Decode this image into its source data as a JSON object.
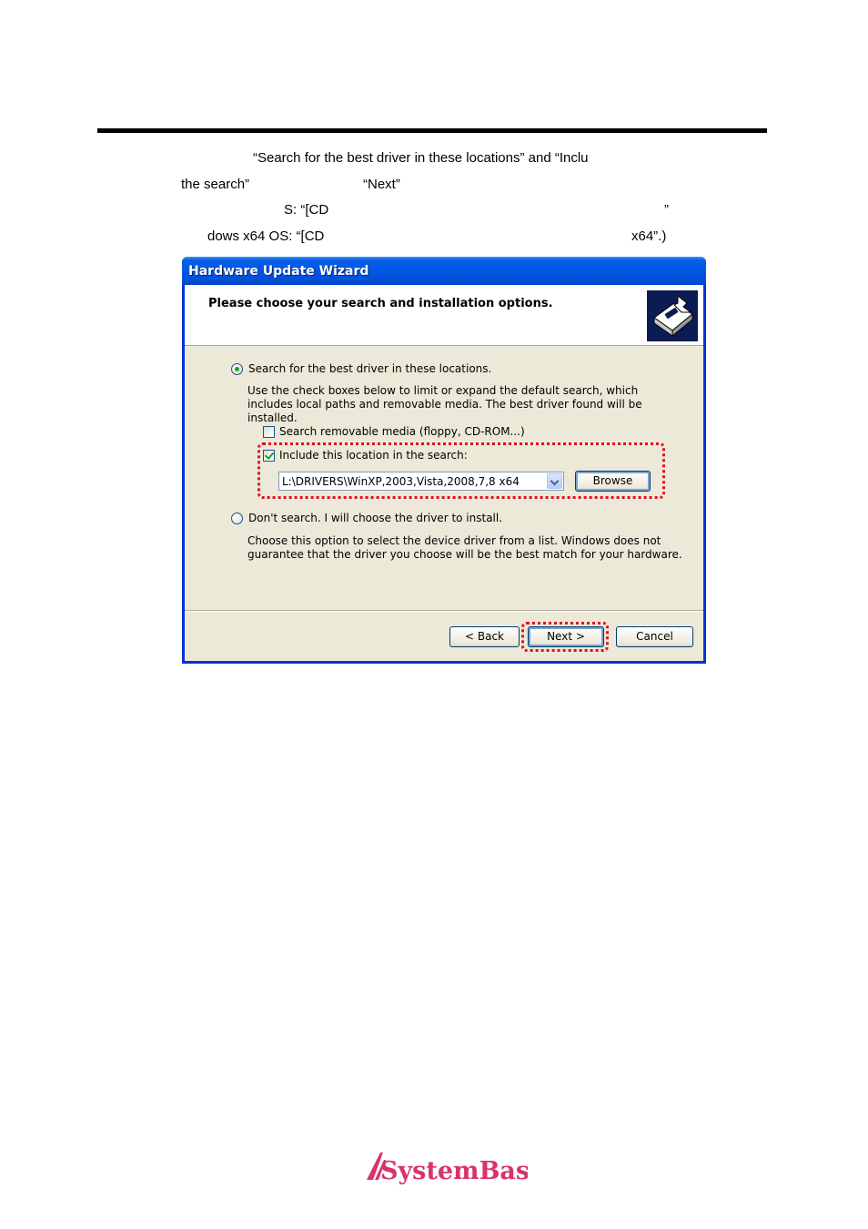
{
  "doc": {
    "line1": "“Search for the best driver in these locations” and “Inclu",
    "line2a": "the search”",
    "line2b": "“Next”",
    "line3a": "S: “[CD",
    "line3b": "”",
    "line4a": "dows x64 OS: “[CD",
    "line4b": "x64”.)"
  },
  "dialog": {
    "title": "Hardware Update Wizard",
    "header_title": "Please choose your search and installation options.",
    "header_icon": "hardware-install-icon",
    "option_search": {
      "label": "Search for the best driver in these locations.",
      "selected": true,
      "description": "Use the check boxes below to limit or expand the default search, which includes local paths and removable media. The best driver found will be installed."
    },
    "check_removable": {
      "label": "Search removable media (floppy, CD-ROM...)",
      "checked": false
    },
    "check_location": {
      "label": "Include this location in the search:",
      "checked": true
    },
    "location_value": "L:\\DRIVERS\\WinXP,2003,Vista,2008,7,8 x64",
    "browse_label": "Browse",
    "option_dont_search": {
      "label": "Don't search. I will choose the driver to install.",
      "selected": false,
      "description": "Choose this option to select the device driver from a list.  Windows does not guarantee that the driver you choose will be the best match for your hardware."
    },
    "back_label": "< Back",
    "next_label": "Next >",
    "cancel_label": "Cancel"
  },
  "logo": {
    "text": "SystemBase",
    "color": "#d8336e"
  },
  "colors": {
    "highlight": "#e01020",
    "xp_blue": "#0054e3"
  }
}
